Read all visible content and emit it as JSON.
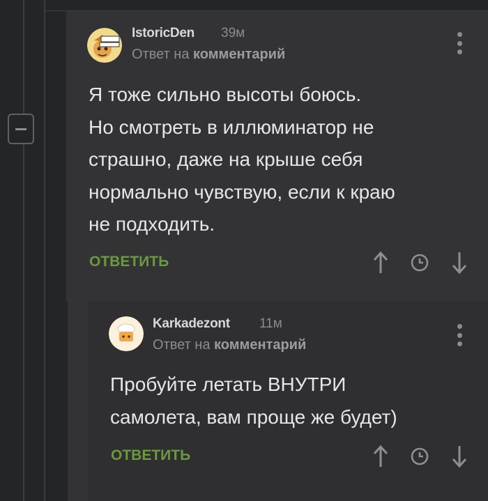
{
  "comments": [
    {
      "username": "IstoricDen",
      "time": "39м",
      "reply_prefix": "Ответ на ",
      "reply_target": "комментарий",
      "text_lines": [
        "Я тоже сильно высоты боюсь.",
        "Но смотреть в иллюминатор не",
        "страшно, даже на крыше себя",
        "нормально чувствую, если к краю",
        "не подходить."
      ],
      "reply_label": "ОТВЕТИТЬ"
    },
    {
      "username": "Karkadezont",
      "time": "11м",
      "reply_prefix": "Ответ на ",
      "reply_target": "комментарий",
      "text_lines": [
        "Пробуйте летать ВНУТРИ",
        "самолета, вам проще же будет)"
      ],
      "reply_label": "ОТВЕТИТЬ"
    }
  ],
  "colors": {
    "accent": "#6a9a3c",
    "background": "#232528",
    "panel": "#333335"
  },
  "icons": [
    "minus-icon",
    "kebab-menu-icon",
    "arrow-up-icon",
    "clock-icon",
    "arrow-down-icon"
  ]
}
